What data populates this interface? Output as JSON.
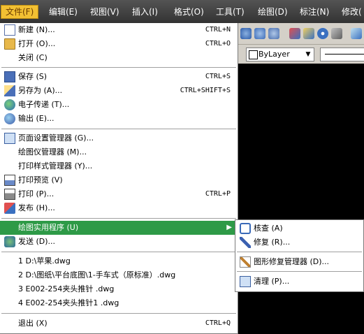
{
  "menubar": {
    "items": [
      "文件(F)",
      "编辑(E)",
      "视图(V)",
      "插入(I)",
      "格式(O)",
      "工具(T)",
      "绘图(D)",
      "标注(N)",
      "修改("
    ]
  },
  "toolbar": {
    "layer_value": "ByLayer",
    "dropdown_arrow": "▼"
  },
  "file_menu": {
    "items": [
      {
        "label": "新建 (N)...",
        "shortcut": "CTRL+N",
        "icon": "new-document-icon"
      },
      {
        "label": "打开 (O)...",
        "shortcut": "CTRL+O",
        "icon": "open-folder-icon"
      },
      {
        "label": "关闭 (C)",
        "shortcut": "",
        "icon": ""
      },
      {
        "label": "保存 (S)",
        "shortcut": "CTRL+S",
        "icon": "save-disk-icon"
      },
      {
        "label": "另存为 (A)...",
        "shortcut": "CTRL+SHIFT+S",
        "icon": "save-as-icon"
      },
      {
        "label": "电子传递 (T)...",
        "shortcut": "",
        "icon": "etransmit-icon"
      },
      {
        "label": "输出 (E)...",
        "shortcut": "",
        "icon": "export-icon"
      },
      {
        "label": "页面设置管理器 (G)...",
        "shortcut": "",
        "icon": "page-setup-icon"
      },
      {
        "label": "绘图仪管理器 (M)...",
        "shortcut": "",
        "icon": ""
      },
      {
        "label": "打印样式管理器 (Y)...",
        "shortcut": "",
        "icon": ""
      },
      {
        "label": "打印预览 (V)",
        "shortcut": "",
        "icon": "print-preview-icon"
      },
      {
        "label": "打印 (P)...",
        "shortcut": "CTRL+P",
        "icon": "printer-icon"
      },
      {
        "label": "发布 (H)...",
        "shortcut": "",
        "icon": "publish-icon"
      },
      {
        "label": "绘图实用程序 (U)",
        "shortcut": "",
        "icon": "",
        "submenu_arrow": "▶"
      },
      {
        "label": "发送 (D)...",
        "shortcut": "",
        "icon": "send-icon"
      },
      {
        "label": "1 D:\\苹果.dwg",
        "shortcut": "",
        "icon": ""
      },
      {
        "label": "2 D:\\图纸\\平台底图\\1-手车式（原标准）.dwg",
        "shortcut": "",
        "icon": ""
      },
      {
        "label": "3 E002-254夹头推针 .dwg",
        "shortcut": "",
        "icon": ""
      },
      {
        "label": "4 E002-254夹头推针1 .dwg",
        "shortcut": "",
        "icon": ""
      },
      {
        "label": "退出 (X)",
        "shortcut": "CTRL+Q",
        "icon": ""
      }
    ]
  },
  "submenu": {
    "items": [
      {
        "label": "核查 (A)",
        "icon": "audit-icon"
      },
      {
        "label": "修复 (R)...",
        "icon": "recover-wrench-icon"
      },
      {
        "label": "图形修复管理器 (D)...",
        "icon": "drawing-recovery-icon"
      },
      {
        "label": "清理 (P)...",
        "icon": "purge-icon"
      }
    ]
  }
}
